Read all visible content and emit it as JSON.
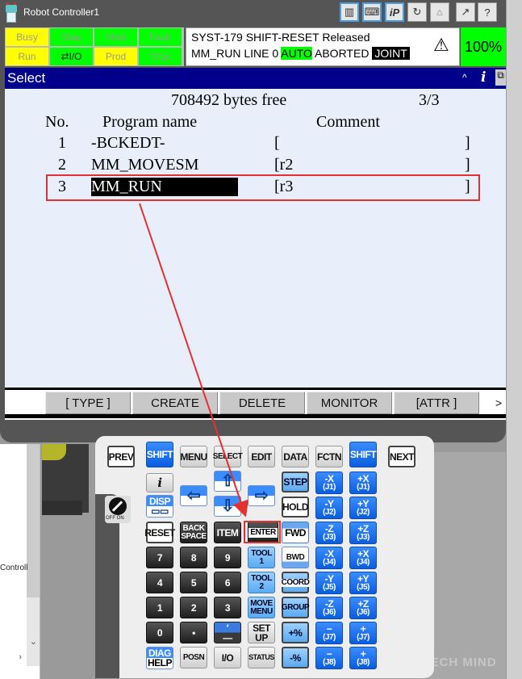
{
  "window": {
    "title": "Robot Controller1",
    "toolbar": [
      {
        "name": "pendant-icon",
        "glyph": "▥",
        "selected": true
      },
      {
        "name": "keyboard-icon",
        "glyph": "⌨",
        "selected": true
      },
      {
        "name": "ip-icon",
        "glyph": "iP",
        "selected": true
      },
      {
        "name": "refresh-icon",
        "glyph": "↻",
        "selected": false
      },
      {
        "name": "robot-icon",
        "glyph": "⩟",
        "selected": false,
        "disabled": true
      },
      {
        "name": "export-icon",
        "glyph": "↗",
        "selected": false
      },
      {
        "name": "help-icon",
        "glyph": "?",
        "selected": false
      }
    ]
  },
  "status": {
    "indicators": [
      {
        "label": "Busy",
        "color": "yellow",
        "active": false
      },
      {
        "label": "Step",
        "color": "green",
        "active": false
      },
      {
        "label": "Hold",
        "color": "green",
        "active": false
      },
      {
        "label": "Fault",
        "color": "green",
        "active": false
      },
      {
        "label": "Run",
        "color": "yellow",
        "active": false
      },
      {
        "label": "I/O",
        "color": "green",
        "active": true
      },
      {
        "label": "Prod",
        "color": "yellow",
        "active": false
      },
      {
        "label": "TCyc",
        "color": "green",
        "active": false
      }
    ],
    "message_line1": "SYST-179 SHIFT-RESET Released",
    "message_line2_prefix": "MM_RUN LINE 0 ",
    "mode": "AUTO",
    "state": " ABORTED ",
    "coord": "JOINT",
    "override": "100%",
    "colors": {
      "yellow": "#ffff00",
      "green": "#00ff00"
    }
  },
  "screen": {
    "title": "Select",
    "bytes_free": "708492 bytes free",
    "page": "3/3",
    "headers": {
      "no": "No.",
      "name": "Program name",
      "comment": "Comment"
    },
    "programs": [
      {
        "no": "1",
        "name": "-BCKEDT-",
        "comment": "[",
        "comment_end": "]"
      },
      {
        "no": "2",
        "name": "MM_MOVESM",
        "comment": "[r2",
        "comment_end": "]"
      },
      {
        "no": "3",
        "name": "MM_RUN",
        "comment": "[r3",
        "comment_end": "]",
        "selected": true
      }
    ]
  },
  "function_keys": [
    "[ TYPE ]",
    "CREATE",
    "DELETE",
    "MONITOR",
    "[ATTR ]"
  ],
  "function_next": ">",
  "pendant": {
    "keys": {
      "prev": "PREV",
      "shift": "SHIFT",
      "menu": "MENU",
      "select": "SELECT",
      "edit": "EDIT",
      "data": "DATA",
      "fctn": "FCTN",
      "next": "NEXT",
      "info": "i",
      "disp": "DISP",
      "step": "STEP",
      "hold": "HOLD",
      "fwd": "FWD",
      "bwd": "BWD",
      "coord": "COORD",
      "group": "GROUP",
      "reset": "RESET",
      "back": "BACK",
      "space": "SPACE",
      "item": "ITEM",
      "enter": "ENTER",
      "tool": "TOOL",
      "one": "1",
      "two": "2",
      "move": "MOVE",
      "menu2": "MENU",
      "set": "SET",
      "up": "UP",
      "diag": "DIAG",
      "help": "HELP",
      "posn": "POSN",
      "io": "I/O",
      "status": "STATUS",
      "plus_pct": "+%",
      "minus_pct": "-%",
      "digits": [
        "7",
        "8",
        "9",
        "4",
        "5",
        "6",
        "1",
        "2",
        "3",
        "0",
        "."
      ],
      "dash": "−"
    },
    "jog": [
      {
        "m": "-X",
        "p": "+X",
        "j": "(J1)"
      },
      {
        "m": "-Y",
        "p": "+Y",
        "j": "(J2)"
      },
      {
        "m": "-Z",
        "p": "+Z",
        "j": "(J3)"
      },
      {
        "m": "-X",
        "p": "+X",
        "j": "(J4)"
      },
      {
        "m": "-Y",
        "p": "+Y",
        "j": "(J5)"
      },
      {
        "m": "-Z",
        "p": "+Z",
        "j": "(J6)"
      },
      {
        "m": "−",
        "p": "+",
        "j": "(J7)"
      },
      {
        "m": "−",
        "p": "+",
        "j": "(J8)"
      }
    ],
    "switch_label": "OFF  ON"
  },
  "background": {
    "side_text": "Controll",
    "watermark": "MECH MIND"
  },
  "annotation": {
    "color": "#e53030"
  }
}
